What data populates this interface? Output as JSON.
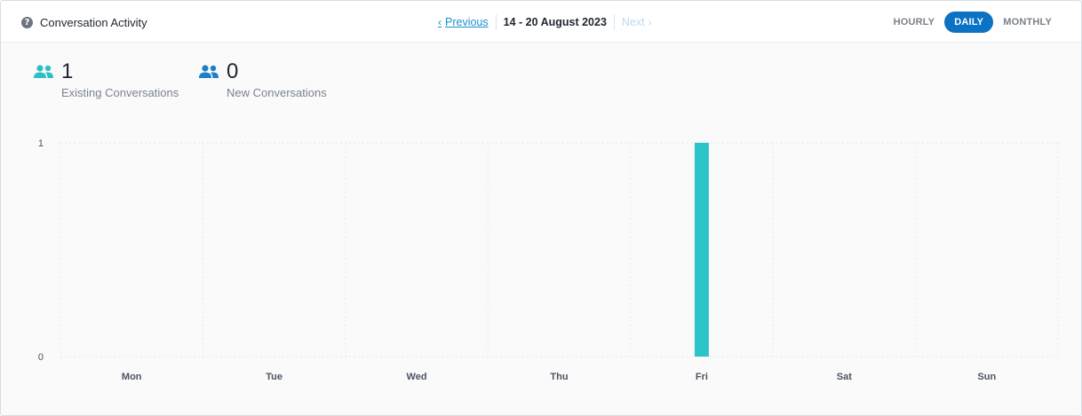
{
  "header": {
    "title": "Conversation Activity",
    "prev_label": "Previous",
    "next_label": "Next",
    "date_range": "14 - 20 August 2023",
    "periods": [
      {
        "label": "HOURLY",
        "active": false
      },
      {
        "label": "DAILY",
        "active": true
      },
      {
        "label": "MONTHLY",
        "active": false
      }
    ]
  },
  "stats": [
    {
      "value": "1",
      "label": "Existing Conversations",
      "color": "#2bbfc6"
    },
    {
      "value": "0",
      "label": "New Conversations",
      "color": "#1f7fc6"
    }
  ],
  "chart_data": {
    "type": "bar",
    "categories": [
      "Mon",
      "Tue",
      "Wed",
      "Thu",
      "Fri",
      "Sat",
      "Sun"
    ],
    "series": [
      {
        "values": [
          0,
          0,
          0,
          0,
          1,
          0,
          0
        ],
        "color": "#2bc4c8"
      }
    ],
    "ylim": [
      0,
      1
    ],
    "yticks": [
      "1",
      "0"
    ],
    "grid": true
  }
}
